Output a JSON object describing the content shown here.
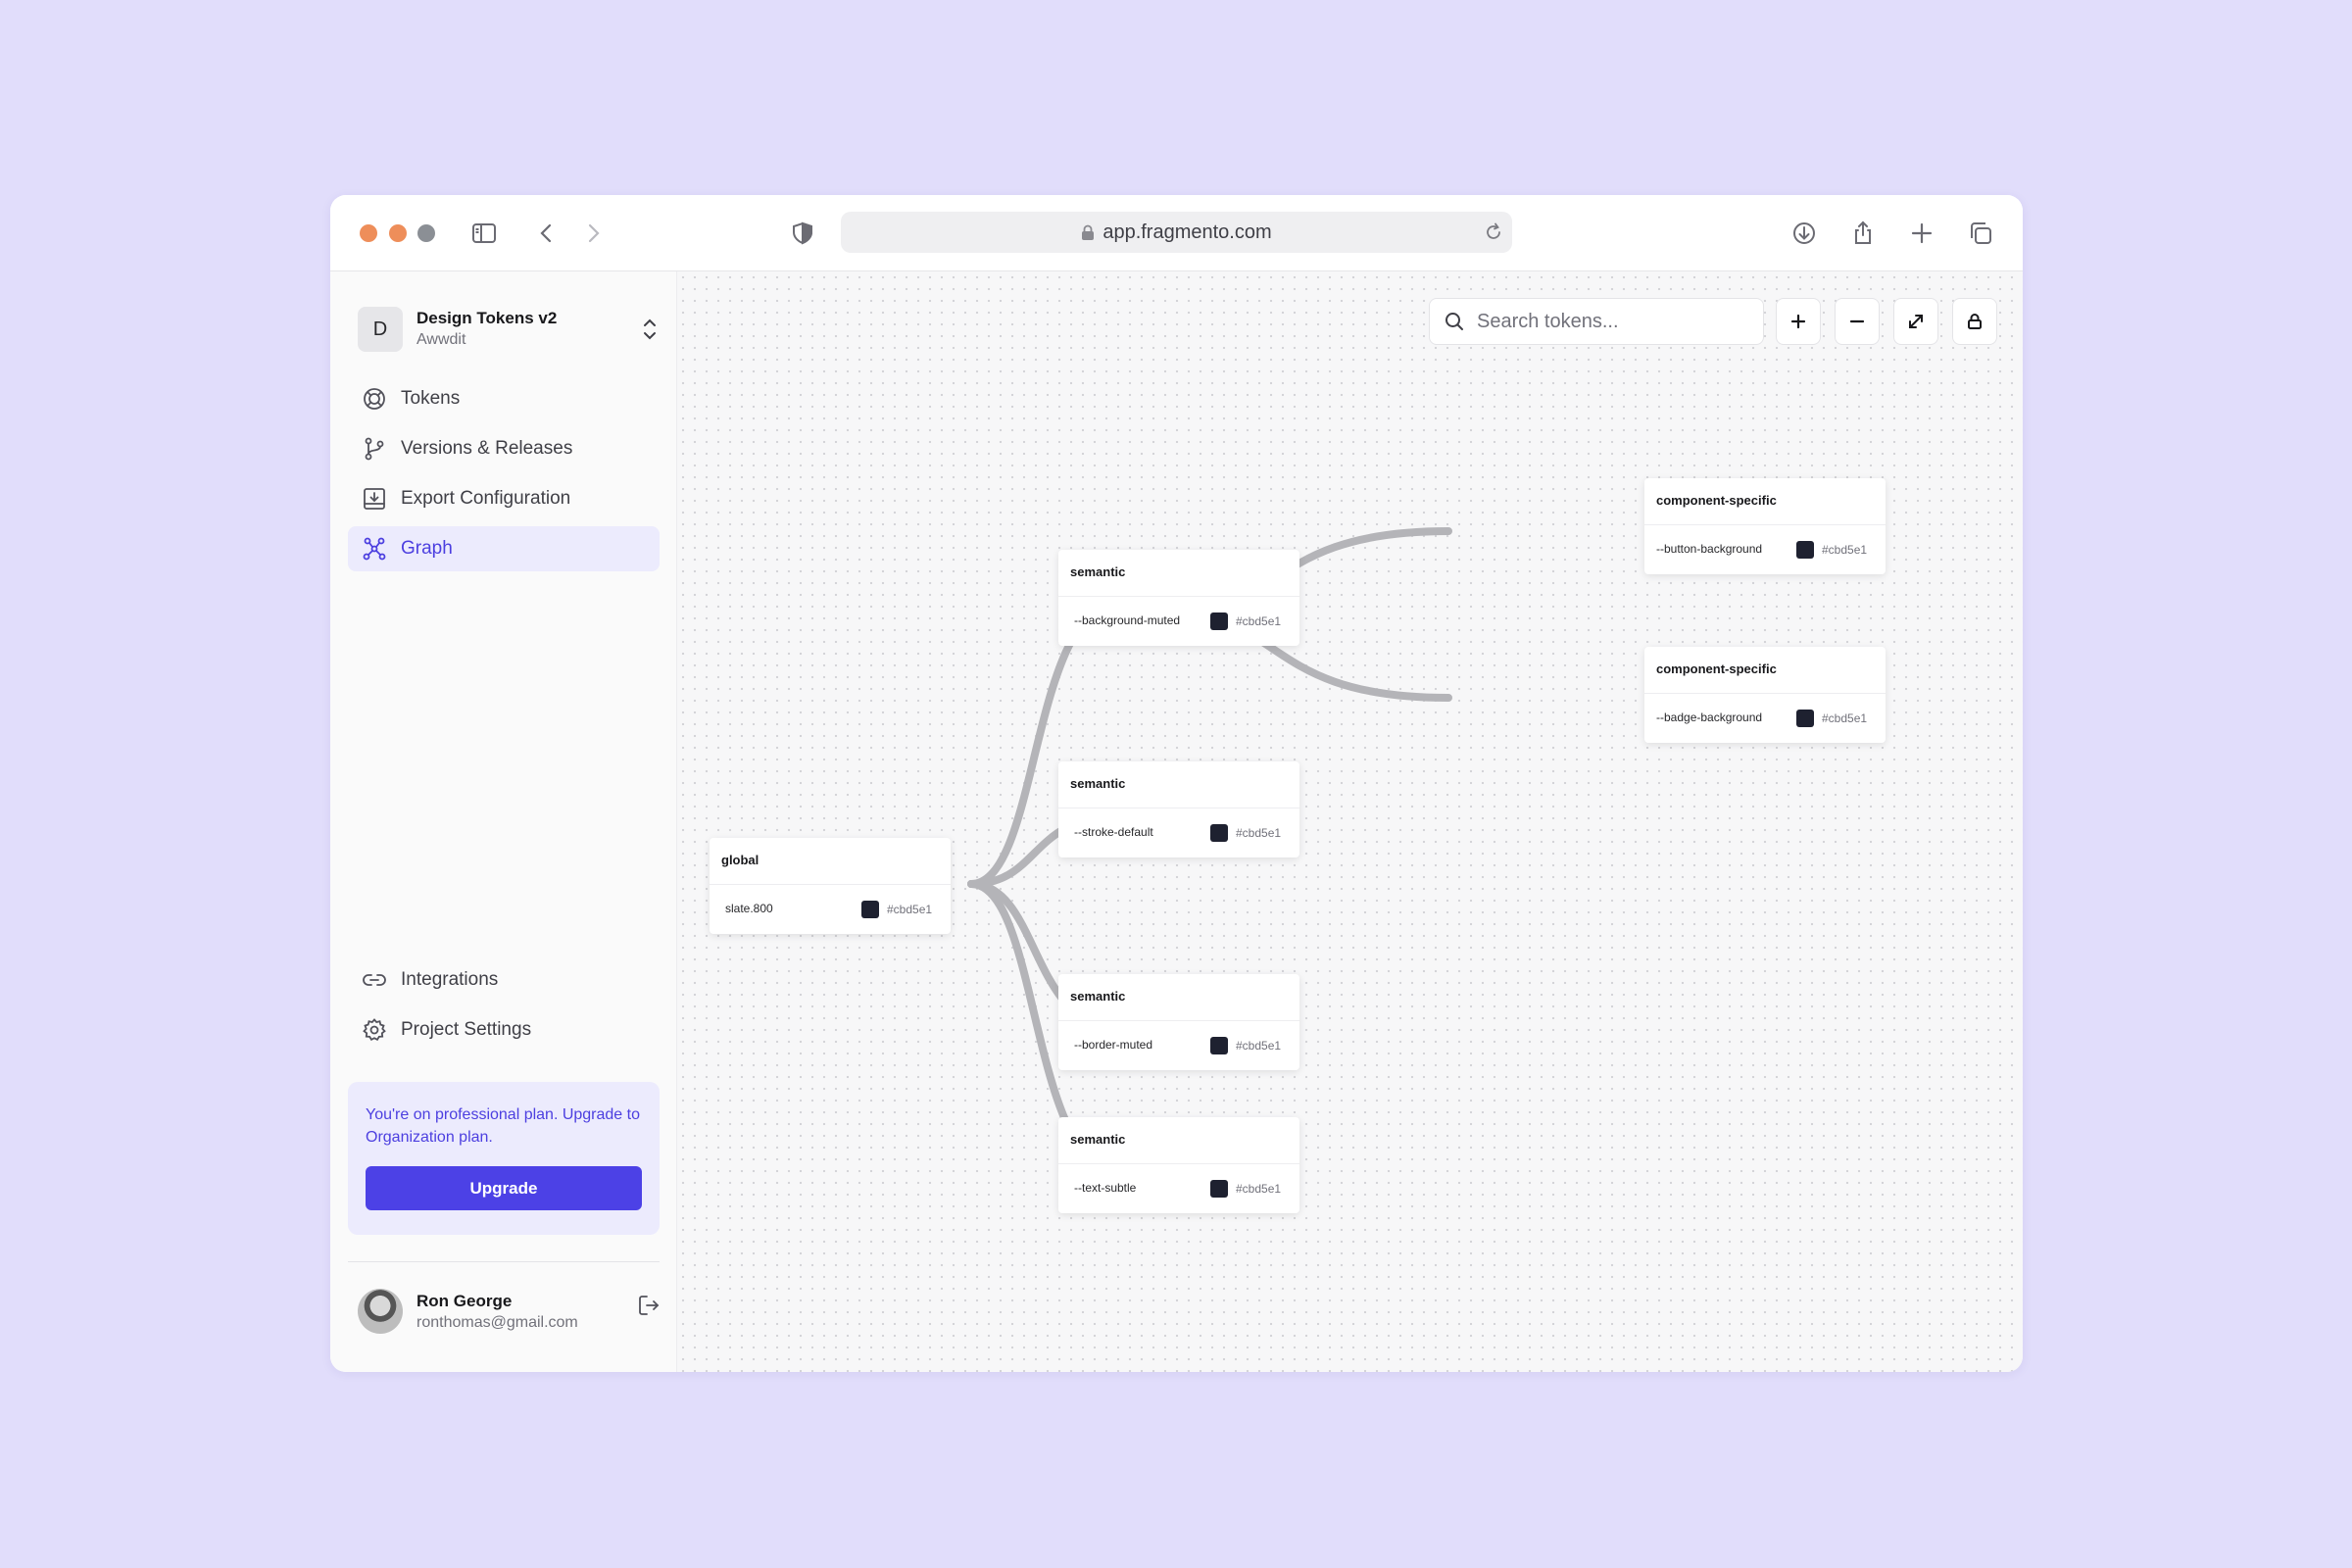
{
  "browser": {
    "url": "app.fragmento.com"
  },
  "sidebar": {
    "project": {
      "initial": "D",
      "name": "Design Tokens v2",
      "org": "Awwdit"
    },
    "nav": [
      {
        "label": "Tokens",
        "icon": "tokens-icon"
      },
      {
        "label": "Versions & Releases",
        "icon": "git-branch-icon"
      },
      {
        "label": "Export Configuration",
        "icon": "export-icon"
      },
      {
        "label": "Graph",
        "icon": "graph-icon",
        "active": true
      }
    ],
    "bottom_nav": [
      {
        "label": "Integrations",
        "icon": "link-icon"
      },
      {
        "label": "Project Settings",
        "icon": "gear-icon"
      }
    ],
    "upgrade": {
      "text": "You're on professional plan. Upgrade to Organization plan.",
      "button": "Upgrade"
    },
    "user": {
      "name": "Ron George",
      "email": "ronthomas@gmail.com"
    }
  },
  "canvas": {
    "search_placeholder": "Search tokens...",
    "nodes": [
      {
        "group": "global",
        "token": "slate.800",
        "color": "#cbd5e1"
      },
      {
        "group": "semantic",
        "token": "--background-muted",
        "color": "#cbd5e1"
      },
      {
        "group": "semantic",
        "token": "--stroke-default",
        "color": "#cbd5e1"
      },
      {
        "group": "semantic",
        "token": "--border-muted",
        "color": "#cbd5e1"
      },
      {
        "group": "semantic",
        "token": "--text-subtle",
        "color": "#cbd5e1"
      },
      {
        "group": "component-specific",
        "token": "--button-background",
        "color": "#cbd5e1"
      },
      {
        "group": "component-specific",
        "token": "--badge-background",
        "color": "#cbd5e1"
      }
    ]
  },
  "colors": {
    "page_bg": "#e1ddfb",
    "accent": "#4c41e6",
    "swatch": "#1e2130",
    "traffic_close": "#ee8e5a",
    "traffic_min": "#ee8e5a",
    "traffic_max": "#8b8f95"
  }
}
